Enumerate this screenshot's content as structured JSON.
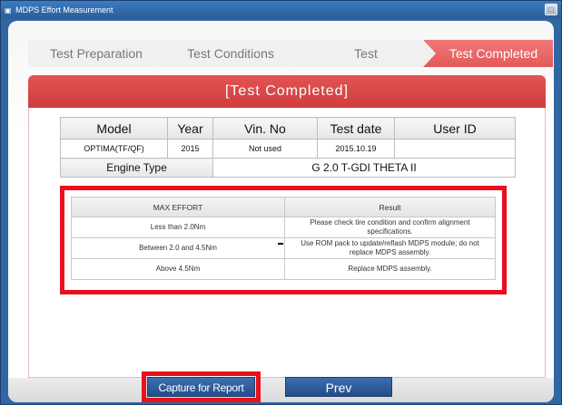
{
  "window": {
    "title": "MDPS Effort Measurement",
    "icon": "app-icon",
    "maximize_icon": "maximize-icon"
  },
  "steps": [
    {
      "label": "Test Preparation",
      "active": false
    },
    {
      "label": "Test Conditions",
      "active": false
    },
    {
      "label": "Test",
      "active": false
    },
    {
      "label": "Test Completed",
      "active": true
    }
  ],
  "banner": {
    "title": "[Test Completed]"
  },
  "info_table": {
    "headers": [
      "Model",
      "Year",
      "Vin. No",
      "Test date",
      "User ID"
    ],
    "values": [
      "OPTIMA(TF/QF)",
      "2015",
      "Not used",
      "2015.10.19",
      ""
    ],
    "engine_label": "Engine Type",
    "engine_value": "G 2.0 T-GDI THETA II"
  },
  "effort_table": {
    "headers": [
      "MAX EFFORT",
      "Result"
    ],
    "rows": [
      [
        "Less than 2.0Nm",
        "Please check tire condition and confirm alignment specifications."
      ],
      [
        "Between 2.0 and 4.5Nm",
        "Use ROM pack to update/reflash MDPS module; do not replace MDPS assembly."
      ],
      [
        "Above 4.5Nm",
        "Replace MDPS assembly."
      ]
    ]
  },
  "buttons": {
    "capture": "Capture for Report",
    "prev": "Prev"
  },
  "colors": {
    "accent_red": "#e35454",
    "highlight_red": "#e8101c",
    "button_blue": "#2a5d99",
    "window_blue": "#2f67a3"
  }
}
